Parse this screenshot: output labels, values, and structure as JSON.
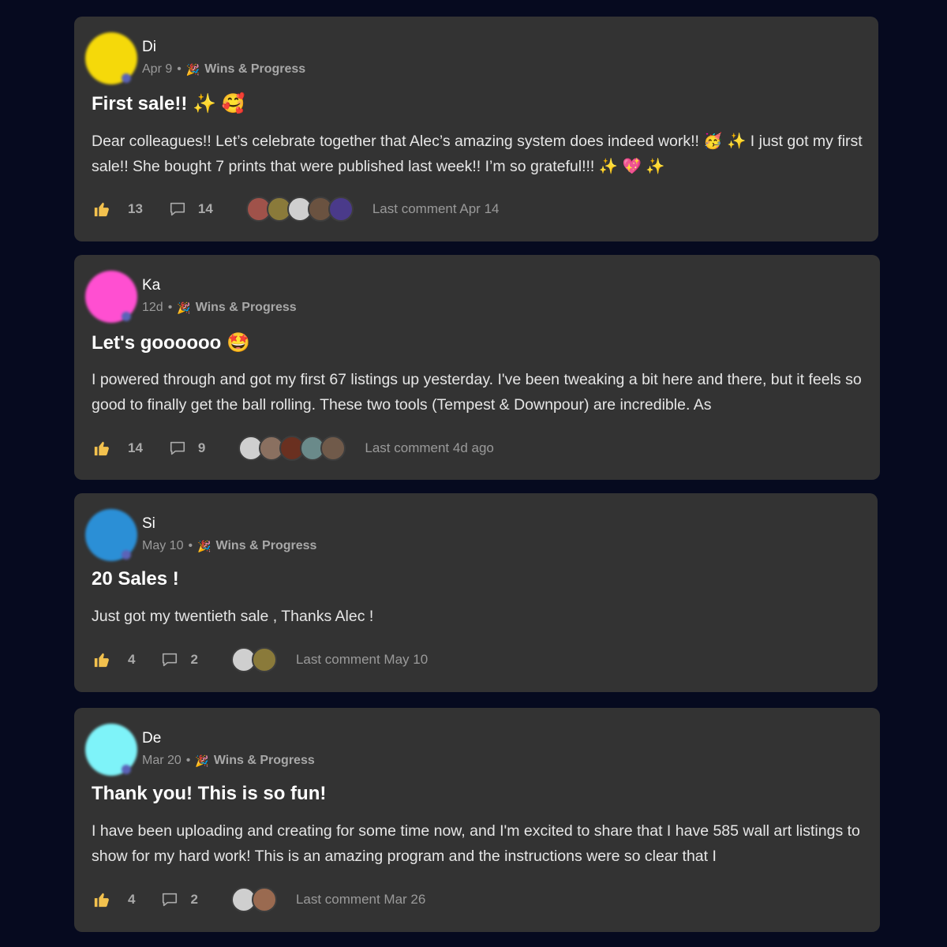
{
  "posts": [
    {
      "author": "Di",
      "date": "Apr 9",
      "category": "Wins & Progress",
      "title": "First sale!! ✨ 🥰",
      "body": "Dear colleagues!! Let’s celebrate together that Alec’s amazing system does indeed work!! 🥳  ✨ I just got my first sale!! She bought 7 prints that were published last week!! I’m so grateful!!! ✨ 💖 ✨",
      "likes": "13",
      "comments": "14",
      "last_comment": "Last comment Apr 14",
      "avatar_color": "#f5d90a",
      "face_colors": [
        "#a0524a",
        "#8a7a3a",
        "#cfcfcf",
        "#6a5240",
        "#4a3a8a"
      ]
    },
    {
      "author": "Ka",
      "date": "12d",
      "category": "Wins & Progress",
      "title": "Let's goooooo 🤩",
      "body": "I powered through and got my first 67 listings up yesterday. I've been tweaking a bit here and there, but it feels so good to finally get the ball rolling. These two tools (Tempest & Downpour) are incredible. As",
      "likes": "14",
      "comments": "9",
      "last_comment": "Last comment 4d ago",
      "avatar_color": "#ff4fd1",
      "face_colors": [
        "#cfcfcf",
        "#8a7060",
        "#6a3020",
        "#6a8a8a",
        "#705a4a"
      ]
    },
    {
      "author": "Si",
      "date": "May 10",
      "category": "Wins & Progress",
      "title": "20 Sales !",
      "body": "Just got my twentieth sale , Thanks Alec !",
      "likes": "4",
      "comments": "2",
      "last_comment": "Last comment May 10",
      "avatar_color": "#2b8fd6",
      "face_colors": [
        "#cfcfcf",
        "#8a7a3a"
      ]
    },
    {
      "author": "De",
      "date": "Mar 20",
      "category": "Wins & Progress",
      "title": "Thank you! This is so fun!",
      "body": "I have been uploading and creating for some time now, and I'm excited to share that I have 585 wall art listings to show for my hard work! This is an amazing program and the instructions were so clear that I",
      "likes": "4",
      "comments": "2",
      "last_comment": "Last comment Mar 26",
      "avatar_color": "#7ef3f9",
      "face_colors": [
        "#cfcfcf",
        "#9a6a50"
      ]
    }
  ]
}
